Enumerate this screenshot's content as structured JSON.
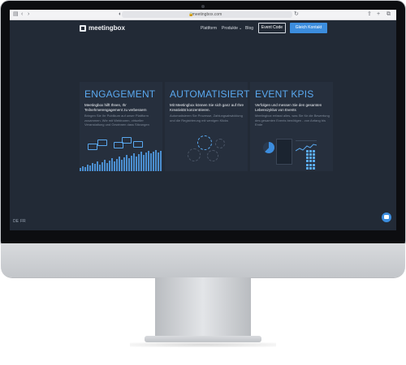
{
  "browser": {
    "url": "meetingbox.com",
    "icons": [
      "sidebar-toggle-icon",
      "back-icon",
      "forward-icon",
      "shield-icon",
      "reload-icon",
      "share-icon",
      "new-tab-icon",
      "tabs-icon"
    ]
  },
  "site": {
    "logo": "meetingbox",
    "nav": {
      "platform": "Plattform",
      "products": "Produkte",
      "blog": "Blog",
      "event_code": "Event Code",
      "contact": "Gleich Kontakt"
    },
    "languages": [
      "DE",
      "FR"
    ]
  },
  "cards": [
    {
      "title": "ENGAGEMENT",
      "subtitle": "Meetingbox hilft Ihnen, Ihr Teilnehmerengagement zu verbessern",
      "description": "Bringen Sie Ihr Publikum auf unser Plattform zusammen. Wie mit Webinaren, virtueller Veranstaltung und Gewinnen dass Sitzungen"
    },
    {
      "title": "AUTOMATISIERT",
      "subtitle": "Mit Meetingbox können Sie sich ganz auf Ihre Kreativität konzentrieren.",
      "description": "Automatisieren Sie Prozesse, Zahlungsabwicklung und die Registrierung mit wenigen Klicks"
    },
    {
      "title": "EVENT KPIS",
      "subtitle": "Verfolgen und messen Sie den gesamten Lebenszyklus von Events",
      "description": "Meetingbox erfasst alles, was Sie für die Bewertung des gesamten Events benötigen - von Anfang bis Ende"
    }
  ],
  "colors": {
    "accent": "#3c8dde",
    "title": "#5aa9f0",
    "background": "#222a36",
    "card": "#262f3d"
  }
}
